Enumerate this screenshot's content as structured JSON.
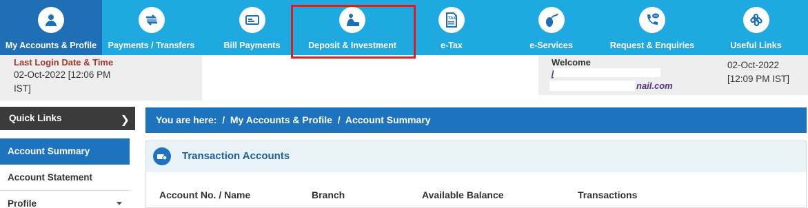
{
  "nav": {
    "items": [
      {
        "label": "My Accounts & Profile",
        "icon": "user-icon"
      },
      {
        "label": "Payments / Transfers",
        "icon": "transfer-arrows-icon"
      },
      {
        "label": "Bill Payments",
        "icon": "bill-card-icon"
      },
      {
        "label": "Deposit & Investment",
        "icon": "money-bag-icon"
      },
      {
        "label": "e-Tax",
        "icon": "tax-document-icon"
      },
      {
        "label": "e-Services",
        "icon": "mouse-icon"
      },
      {
        "label": "Request & Enquiries",
        "icon": "phone-chat-icon"
      },
      {
        "label": "Useful Links",
        "icon": "links-icon"
      }
    ],
    "active_index": 0,
    "highlighted_index": 3
  },
  "login": {
    "title": "Last Login Date & Time",
    "datetime": "02-Oct-2022 [12:06 PM IST]"
  },
  "welcome": {
    "title": "Welcome",
    "email_tail": "nail.com",
    "current_datetime": "02-Oct-2022 [12:09 PM IST]"
  },
  "sidebar": {
    "quick_links": "Quick Links",
    "items": [
      {
        "label": "Account Summary",
        "active": true
      },
      {
        "label": "Account Statement",
        "active": false
      },
      {
        "label": "Profile",
        "active": false
      }
    ]
  },
  "breadcrumb": {
    "text": "You are here:  /  My Accounts & Profile  /  Account Summary"
  },
  "panel": {
    "title": "Transaction Accounts",
    "columns": [
      "Account No. / Name",
      "Branch",
      "Available Balance",
      "Transactions"
    ]
  },
  "colors": {
    "nav_bg": "#1fa9e1",
    "nav_active": "#1e6fb6",
    "highlight_border": "#e01b1b",
    "breadcrumb_bg": "#1e73be"
  }
}
